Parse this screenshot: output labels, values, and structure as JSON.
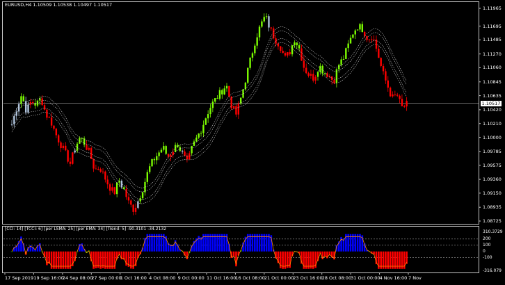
{
  "window": {
    "symbol_line": "EURUSD,H4  1.10509 1.10538 1.10497 1.10517"
  },
  "indicator": {
    "title": "[CCI: 14] [TCCI: 6] [per LSMA: 25] [per EMA: 34] [Trend: 5] -90.3101 -34.2132",
    "levels": [
      {
        "label": "310.3729",
        "value": 310.37
      },
      {
        "label": "200",
        "value": 200
      },
      {
        "label": "100",
        "value": 100
      },
      {
        "label": "0",
        "value": 0
      },
      {
        "label": "-100",
        "value": -100
      },
      {
        "label": "-316.079",
        "value": -316.08
      }
    ]
  },
  "colors": {
    "bull": "#7cfc00",
    "bear": "#ff0000",
    "doji": "#b0c4de",
    "envelope": "#c8c8c8",
    "cci_line": "#ff8c00",
    "cci_pos": "#0000ff",
    "cci_neg": "#ff0000",
    "cci_flat": "#00cc00"
  },
  "chart_data": {
    "type": "candlestick",
    "symbol": "EURUSD",
    "timeframe": "H4",
    "current_price": "1.10517",
    "price_axis": [
      "1.11965",
      "1.11695",
      "1.11485",
      "1.11270",
      "1.11060",
      "1.10845",
      "1.10635",
      "1.10420",
      "1.10210",
      "1.10000",
      "1.09785",
      "1.09575",
      "1.09360",
      "1.09150",
      "1.08935",
      "1.08725"
    ],
    "ylim": [
      1.08725,
      1.11965
    ],
    "time_axis": [
      "17 Sep 2019",
      "19 Sep 16:00",
      "24 Sep 08:00",
      "27 Sep 00:00",
      "1 Oct 16:00",
      "4 Oct 08:00",
      "9 Oct 00:00",
      "11 Oct 16:00",
      "16 Oct 08:00",
      "21 Oct 00:00",
      "23 Oct 16:00",
      "28 Oct 08:00",
      "31 Oct 00:00",
      "4 Nov 16:00",
      "7 Nov"
    ],
    "closes": [
      1.102,
      1.1045,
      1.1065,
      1.104,
      1.1055,
      1.105,
      1.106,
      1.1035,
      1.1025,
      1.1005,
      1.099,
      1.0975,
      1.096,
      1.0985,
      1.1,
      1.099,
      1.0975,
      1.095,
      1.0955,
      1.094,
      1.0925,
      1.0915,
      1.0935,
      1.092,
      1.09,
      1.089,
      1.0905,
      1.0925,
      1.095,
      1.0965,
      1.0975,
      1.0985,
      1.097,
      1.098,
      1.099,
      1.0975,
      1.096,
      1.0985,
      1.1,
      1.1015,
      1.1035,
      1.105,
      1.106,
      1.107,
      1.108,
      1.105,
      1.1035,
      1.106,
      1.109,
      1.112,
      1.115,
      1.117,
      1.1185,
      1.1165,
      1.115,
      1.114,
      1.112,
      1.113,
      1.115,
      1.1135,
      1.1105,
      1.1095,
      1.109,
      1.111,
      1.11,
      1.1095,
      1.1085,
      1.111,
      1.112,
      1.114,
      1.116,
      1.117,
      1.1165,
      1.115,
      1.1155,
      1.113,
      1.11,
      1.108,
      1.106,
      1.1065,
      1.1045,
      1.105
    ]
  }
}
